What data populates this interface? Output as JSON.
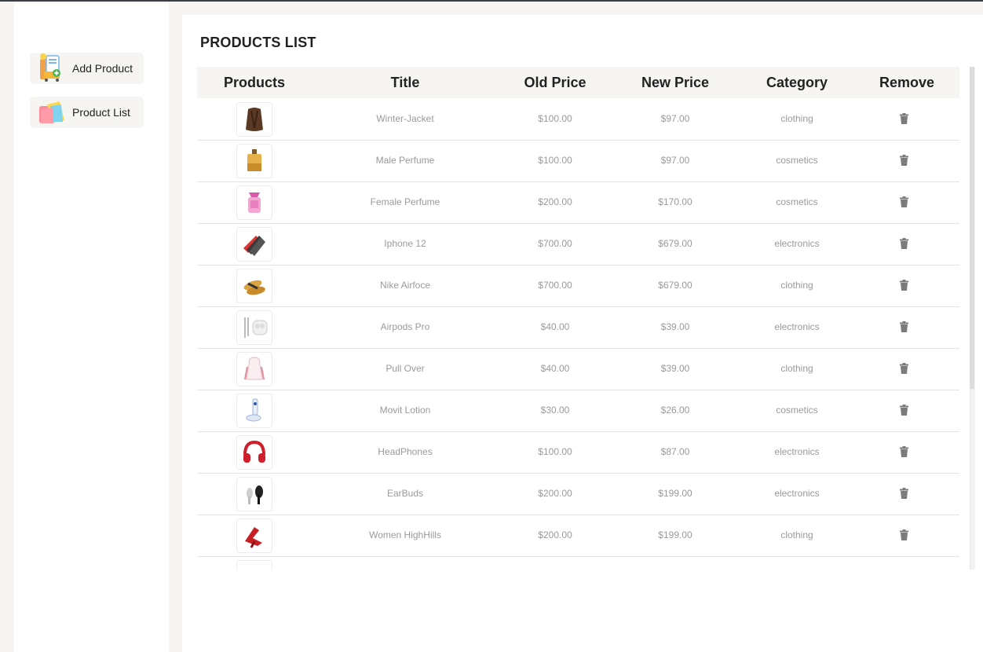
{
  "sidebar": {
    "add_product": {
      "label": "Add Product",
      "icon": "add-product-icon"
    },
    "product_list": {
      "label": "Product List",
      "icon": "product-list-icon"
    }
  },
  "main": {
    "title": "PRODUCTS LIST",
    "columns": [
      "Products",
      "Title",
      "Old Price",
      "New Price",
      "Category",
      "Remove"
    ],
    "rows": [
      {
        "title": "Winter-Jacket",
        "old_price": "$100.00",
        "new_price": "$97.00",
        "category": "clothing",
        "image": "jacket"
      },
      {
        "title": "Male Perfume",
        "old_price": "$100.00",
        "new_price": "$97.00",
        "category": "cosmetics",
        "image": "male-perfume"
      },
      {
        "title": "Female Perfume",
        "old_price": "$200.00",
        "new_price": "$170.00",
        "category": "cosmetics",
        "image": "female-perfume"
      },
      {
        "title": "Iphone 12",
        "old_price": "$700.00",
        "new_price": "$679.00",
        "category": "electronics",
        "image": "phones"
      },
      {
        "title": "Nike Airfoce",
        "old_price": "$700.00",
        "new_price": "$679.00",
        "category": "clothing",
        "image": "sandals"
      },
      {
        "title": "Airpods Pro",
        "old_price": "$40.00",
        "new_price": "$39.00",
        "category": "electronics",
        "image": "earphones"
      },
      {
        "title": "Pull Over",
        "old_price": "$40.00",
        "new_price": "$39.00",
        "category": "clothing",
        "image": "pullover"
      },
      {
        "title": "Movit Lotion",
        "old_price": "$30.00",
        "new_price": "$26.00",
        "category": "cosmetics",
        "image": "lotion"
      },
      {
        "title": "HeadPhones",
        "old_price": "$100.00",
        "new_price": "$87.00",
        "category": "electronics",
        "image": "headphones"
      },
      {
        "title": "EarBuds",
        "old_price": "$200.00",
        "new_price": "$199.00",
        "category": "electronics",
        "image": "earbuds"
      },
      {
        "title": "Women HighHills",
        "old_price": "$200.00",
        "new_price": "$199.00",
        "category": "clothing",
        "image": "heels"
      }
    ],
    "remove_icon": "trash-icon"
  },
  "colors": {
    "page_bg": "#f6f5f1",
    "panel_bg": "#ffffff",
    "cell_text": "#9a9a9a",
    "trash": "#7b7b7b"
  }
}
